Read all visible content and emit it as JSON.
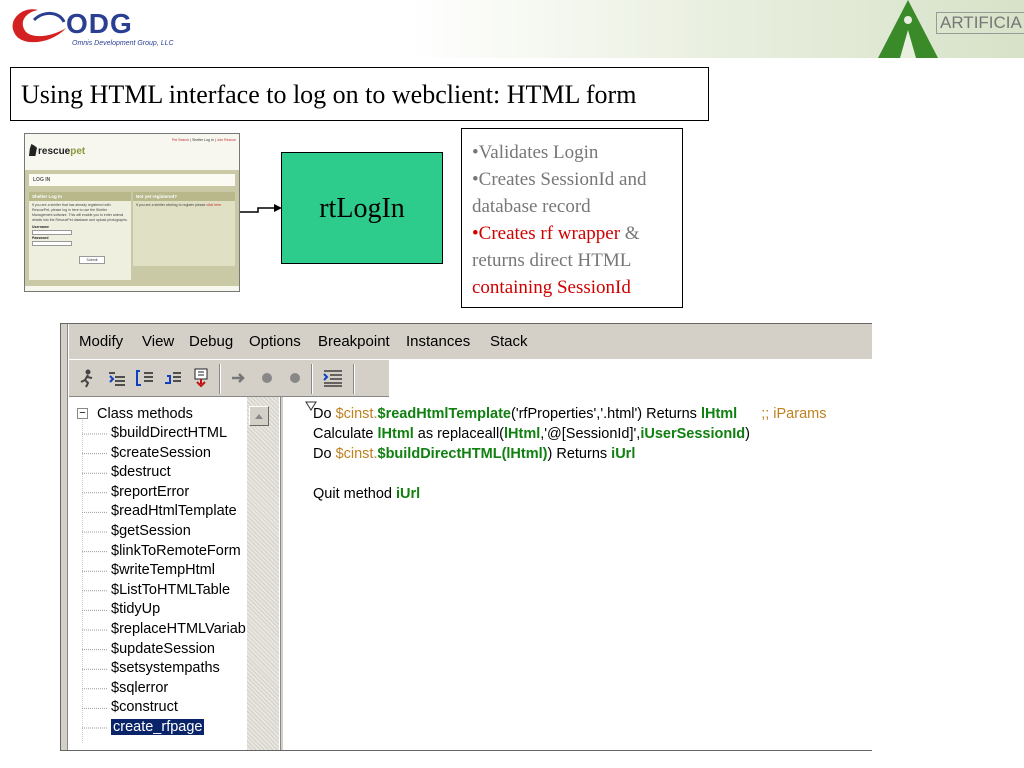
{
  "header": {
    "left_logo": {
      "name": "ODG",
      "subtitle": "Omnis Development Group, LLC"
    },
    "right_logo": {
      "name": "ARTIFICIA"
    }
  },
  "slide_title": "Using HTML interface to log on to webclient: HTML form",
  "thumbnail": {
    "logo_word1": "rescue",
    "logo_word2": "pet",
    "nav_part1": "Pet Search",
    "nav_part2": " | Shelter Log In | ",
    "nav_part3": "Join Rescue",
    "login_heading": "LOG IN",
    "col1_heading": "Shelter Log In",
    "col1_text": "If you are a shelter that has already registered with RescuePet, please log in here to use the Shelter Management software. This will enable you to enter animal details into the RescuePet database and upload photographs.",
    "username_label": "Username",
    "password_label": "Password",
    "submit_label": "Submit",
    "col2_heading": "Not yet registered?",
    "col2_text": "If you are a shelter wishing to register please",
    "col2_link": "click here"
  },
  "process_box": {
    "label": "rtLogIn"
  },
  "bullets": [
    {
      "text": "•Validates Login",
      "color": "#777777"
    },
    {
      "text": "•Creates SessionId and database record",
      "color": "#777777"
    },
    {
      "text": "•Creates rf wrapper",
      "color": "#d00000",
      "suffix": " & returns direct HTML",
      "suffix_color": "#777777"
    },
    {
      "text": "containing SessionId",
      "color": "#d00000"
    }
  ],
  "ide": {
    "menu": [
      "Modify",
      "View",
      "Debug",
      "Options",
      "Breakpoint",
      "Instances",
      "Stack"
    ],
    "toolbar_icons": [
      "runner-icon",
      "step-in-icon",
      "step-over-icon",
      "step-out-icon",
      "breakpoint-down-icon",
      "go-arrow-icon",
      "record-icon",
      "record-icon-2",
      "indent-icon"
    ],
    "tree": {
      "root": "Class methods",
      "items": [
        "$buildDirectHTML",
        "$createSession",
        "$destruct",
        "$reportError",
        "$readHtmlTemplate",
        "$getSession",
        "$linkToRemoteForm",
        "$writeTempHtml",
        "$ListToHTMLTable",
        "$tidyUp",
        "$replaceHTMLVariab",
        "$updateSession",
        "$setsystempaths",
        "$sqlerror",
        "$construct",
        "create_rfpage"
      ],
      "selected": "create_rfpage"
    },
    "code": {
      "line1": {
        "kw": "Do ",
        "obj": "$cinst.",
        "method": "$readHtmlTemplate",
        "args": "('rfProperties','.html') Returns ",
        "var": "lHtml",
        "comment": ";; iParams"
      },
      "line2": {
        "kw": "Calculate ",
        "var1": "lHtml",
        "mid": " as replaceall(",
        "var2": "lHtml",
        "mid2": ",'@[SessionId]',",
        "var3": "iUserSessionId",
        "end": ")"
      },
      "line3": {
        "kw": "Do ",
        "obj": "$cinst.",
        "method": "$buildDirectHTML",
        "lp": "(",
        "var1": "lHtml",
        "rp": ") Returns ",
        "var2": "iUrl"
      },
      "line4": {
        "kw": "Quit method ",
        "var": "iUrl"
      }
    }
  }
}
